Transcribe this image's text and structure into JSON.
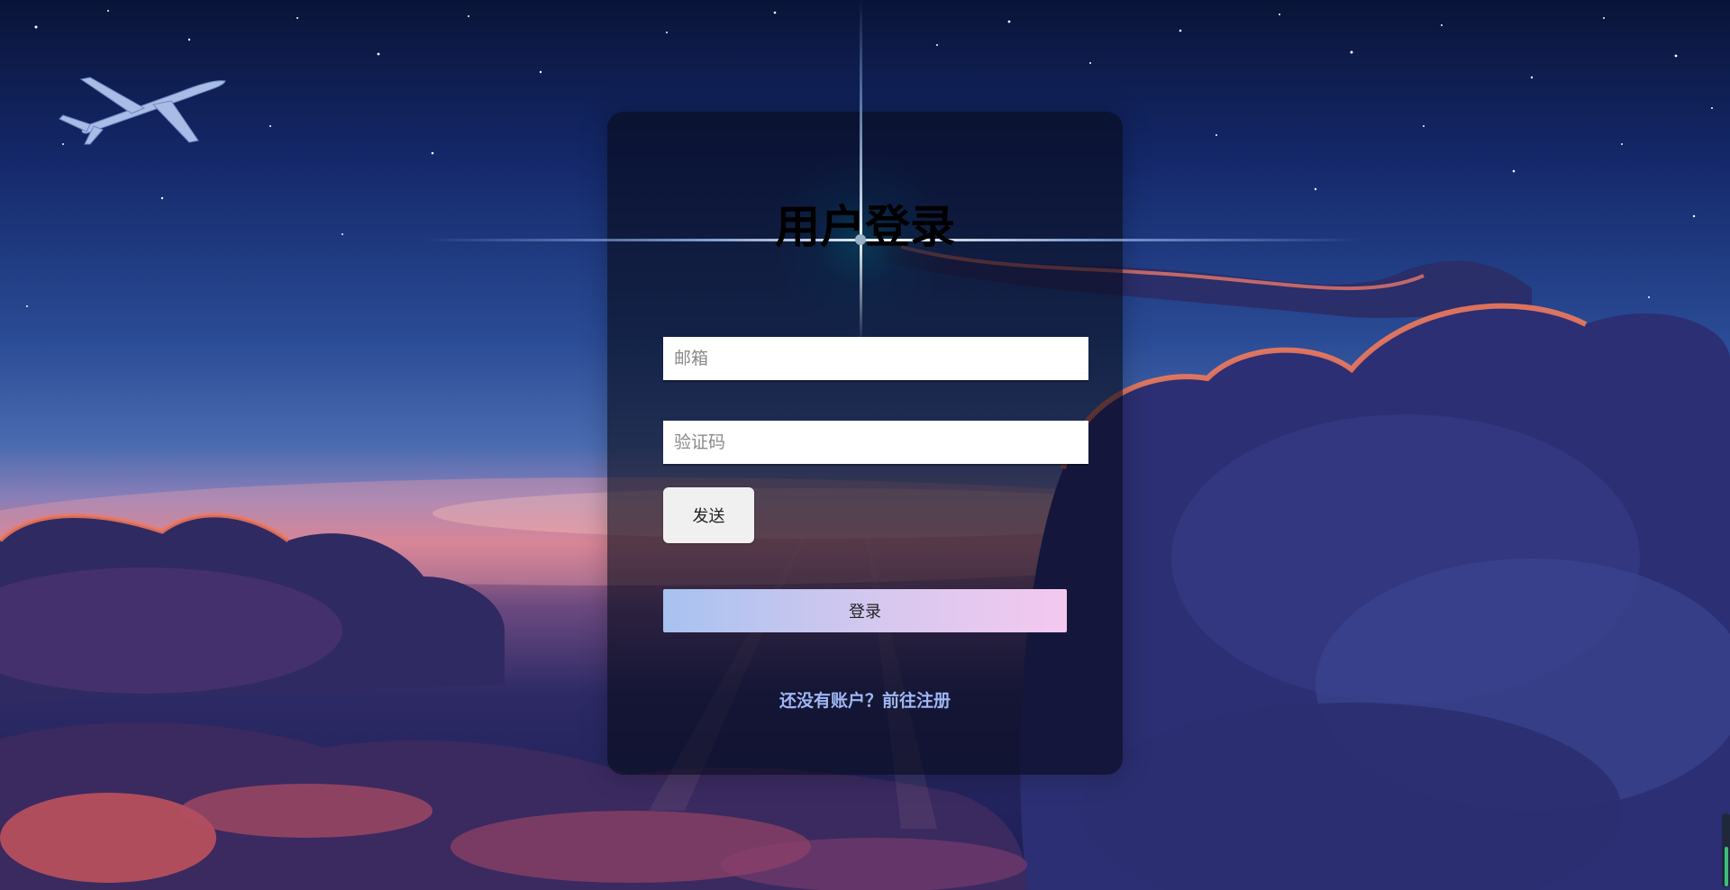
{
  "login": {
    "title": "用户登录",
    "email_placeholder": "邮箱",
    "code_placeholder": "验证码",
    "send_label": "发送",
    "login_label": "登录",
    "register_text": "还没有账户？前往注册"
  },
  "icons": {
    "airplane": "airplane-icon"
  }
}
